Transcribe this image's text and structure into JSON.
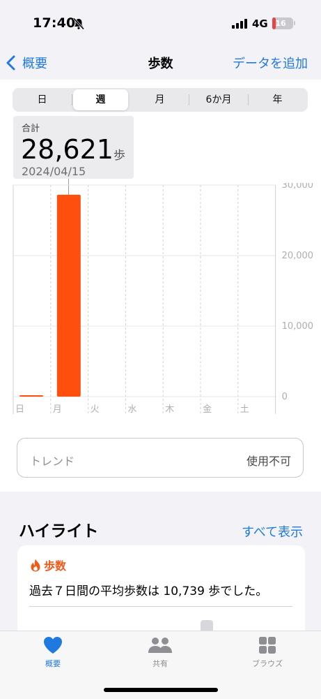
{
  "status_bar": {
    "time": "17:40",
    "network": "4G",
    "battery": "16",
    "battery_level": 0.16
  },
  "nav": {
    "back_label": "概要",
    "title": "歩数",
    "action_label": "データを追加"
  },
  "segments": [
    {
      "label": "日",
      "selected": false
    },
    {
      "label": "週",
      "selected": true
    },
    {
      "label": "月",
      "selected": false
    },
    {
      "label": "6か月",
      "selected": false
    },
    {
      "label": "年",
      "selected": false
    }
  ],
  "summary": {
    "label": "合計",
    "value": "28,621",
    "unit": "歩",
    "date": "2024/04/15"
  },
  "chart_data": {
    "type": "bar",
    "categories": [
      "日",
      "月",
      "火",
      "水",
      "木",
      "金",
      "土"
    ],
    "values": [
      200,
      28621,
      0,
      0,
      0,
      0,
      0
    ],
    "ylim": [
      0,
      30000
    ],
    "y_ticks": [
      0,
      10000,
      20000,
      30000
    ],
    "y_tick_labels": [
      "0",
      "10,000",
      "20,000",
      "30,000"
    ],
    "bar_color": "#ff4f0f",
    "grid": true
  },
  "trend": {
    "label": "トレンド",
    "status": "使用不可"
  },
  "highlights": {
    "title": "ハイライト",
    "show_all": "すべて表示",
    "card_title": "歩数",
    "card_text": "過去７日間の平均歩数は 10,739 歩でした。"
  },
  "tabs": [
    {
      "label": "概要",
      "icon": "heart-icon",
      "active": true
    },
    {
      "label": "共有",
      "icon": "people-icon",
      "active": false
    },
    {
      "label": "ブラウズ",
      "icon": "grid-icon",
      "active": false
    }
  ],
  "colors": {
    "accent": "#1f7ae0",
    "steps": "#ff4f0f",
    "highlight": "#f05a1a"
  }
}
